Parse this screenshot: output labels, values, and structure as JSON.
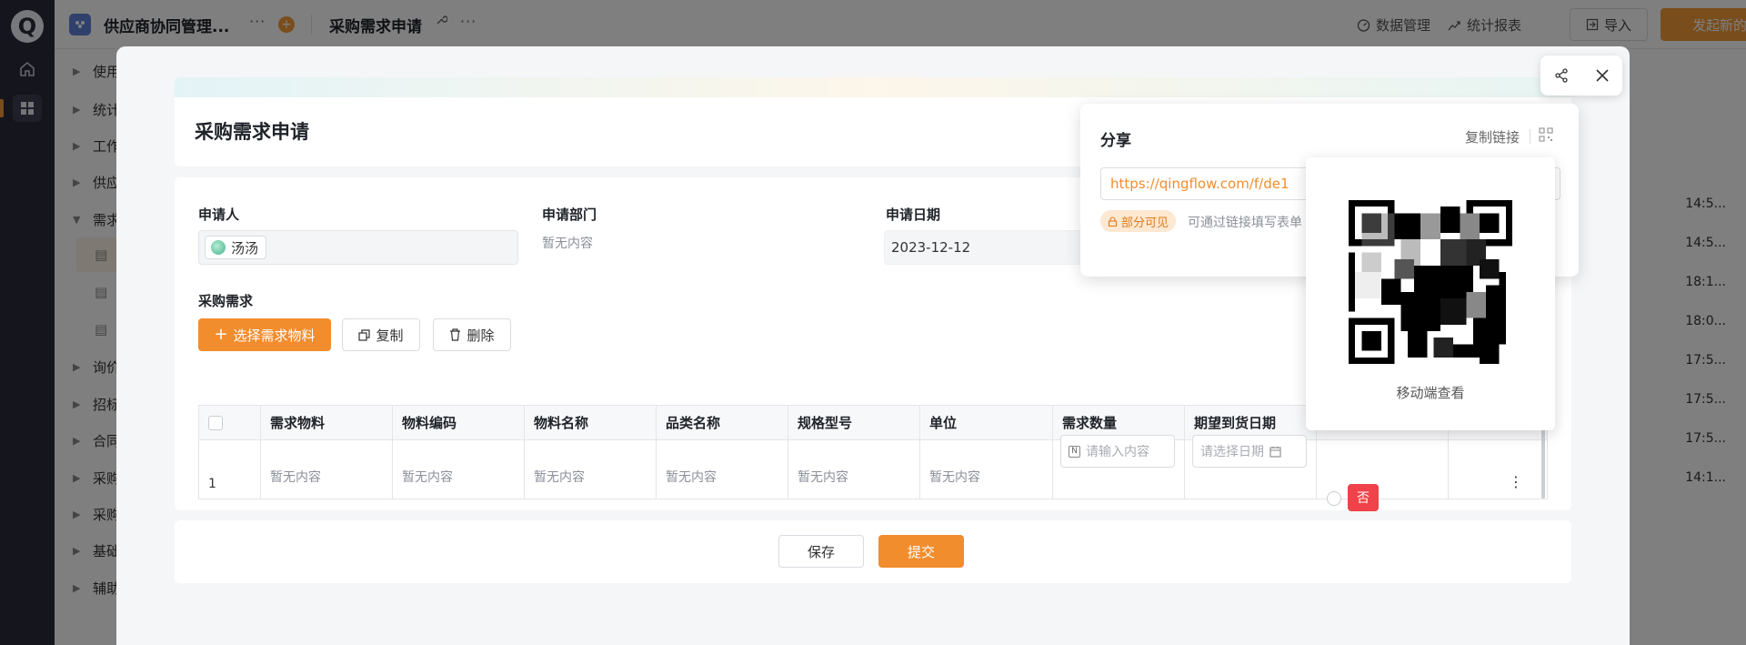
{
  "app": {
    "name": "供应商协同管理...",
    "page_title": "采购需求申请",
    "links": {
      "data_mgmt": "数据管理",
      "stats": "统计报表",
      "import": "导入",
      "start_new": "发起新的"
    }
  },
  "sidebar": {
    "items": [
      {
        "label": "使用"
      },
      {
        "label": "统计"
      },
      {
        "label": "工作"
      },
      {
        "label": "供应"
      },
      {
        "label": "需求"
      },
      {
        "label": "询价"
      },
      {
        "label": "招标"
      },
      {
        "label": "合同"
      },
      {
        "label": "采购"
      },
      {
        "label": "采购"
      },
      {
        "label": "基础"
      },
      {
        "label": "辅助"
      }
    ]
  },
  "background_times": [
    "14:5...",
    "14:5...",
    "18:1...",
    "18:0...",
    "17:5...",
    "17:5...",
    "17:5...",
    "14:1..."
  ],
  "form": {
    "title": "采购需求申请",
    "applicant_label": "申请人",
    "applicant_value": "汤汤",
    "dept_label": "申请部门",
    "dept_value": "暂无内容",
    "date_label": "申请日期",
    "date_value": "2023-12-12",
    "section_label": "采购需求",
    "btn_select": "选择需求物料",
    "btn_copy": "复制",
    "btn_delete": "删除",
    "table": {
      "headers": [
        "需求物料",
        "物料编码",
        "物料名称",
        "品类名称",
        "规格型号",
        "单位",
        "需求数量",
        "期望到货日期"
      ],
      "row_index": "1",
      "row_values": [
        "暂无内容",
        "暂无内容",
        "暂无内容",
        "暂无内容",
        "暂无内容",
        "暂无内容"
      ],
      "qty_placeholder": "请输入内容",
      "date_placeholder": "请选择日期",
      "no_label": "否"
    },
    "save": "保存",
    "submit": "提交"
  },
  "share": {
    "title": "分享",
    "copy_link": "复制链接",
    "url": "https://qingflow.com/f/de1",
    "visibility": "部分可见",
    "visibility_desc": "可通过链接填写表单",
    "qr_caption": "移动端查看"
  },
  "colors": {
    "accent": "#f28d2e",
    "danger": "#f0424a",
    "rail": "#2b2d3a"
  }
}
